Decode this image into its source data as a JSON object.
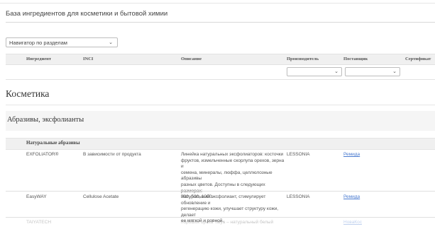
{
  "page": {
    "title": "База ингредиентов для косметики и бытовой химии"
  },
  "navigator": {
    "selected": "Навигатор по разделам",
    "chevron_icon": "chevron-down-icon"
  },
  "table": {
    "columns": {
      "ingredient": "Ингредиент",
      "inci": "INCI",
      "description": "Описание",
      "manufacturer": "Производитель",
      "supplier": "Поставщик",
      "certificate": "Сертификат"
    },
    "filters": {
      "manufacturer": "",
      "supplier": ""
    }
  },
  "section": {
    "title": "Косметика"
  },
  "category": {
    "title": "Абразивы, эксфолианты"
  },
  "subcategory": {
    "title": "Натуральные абразивы"
  },
  "rows": [
    {
      "ingredient": "EXFOLIATOR®",
      "inci": "В зависимости от продукта",
      "description_lines": [
        "Линейка натуральных эксфолиаторов: косточки",
        "фруктов, измельченные скорлупа орехов, зерна и",
        "семена, минералы, люффа, целлюлозные абразивы",
        "разных цветов. Доступны в следующих размерах:",
        "300, 500, 1000."
      ],
      "manufacturer": "LESSONIA",
      "supplier": "Ремида"
    },
    {
      "ingredient": "EasyWAY",
      "inci": "Cellulose Acetate",
      "description_lines": [
        "Натуральный эксфолиант, стимулирует обновление и",
        "регенерацию кожи, улучшает структуру кожи, делает",
        "ее мягкой и ровной."
      ],
      "manufacturer": "LESSONIA",
      "supplier": "Ремида"
    },
    {
      "ingredient": "TAIYATECH",
      "inci": "",
      "description_lines": [
        "порошок ореха Taiya – натуральный белый"
      ],
      "manufacturer": "",
      "supplier": "НоваКос"
    }
  ]
}
